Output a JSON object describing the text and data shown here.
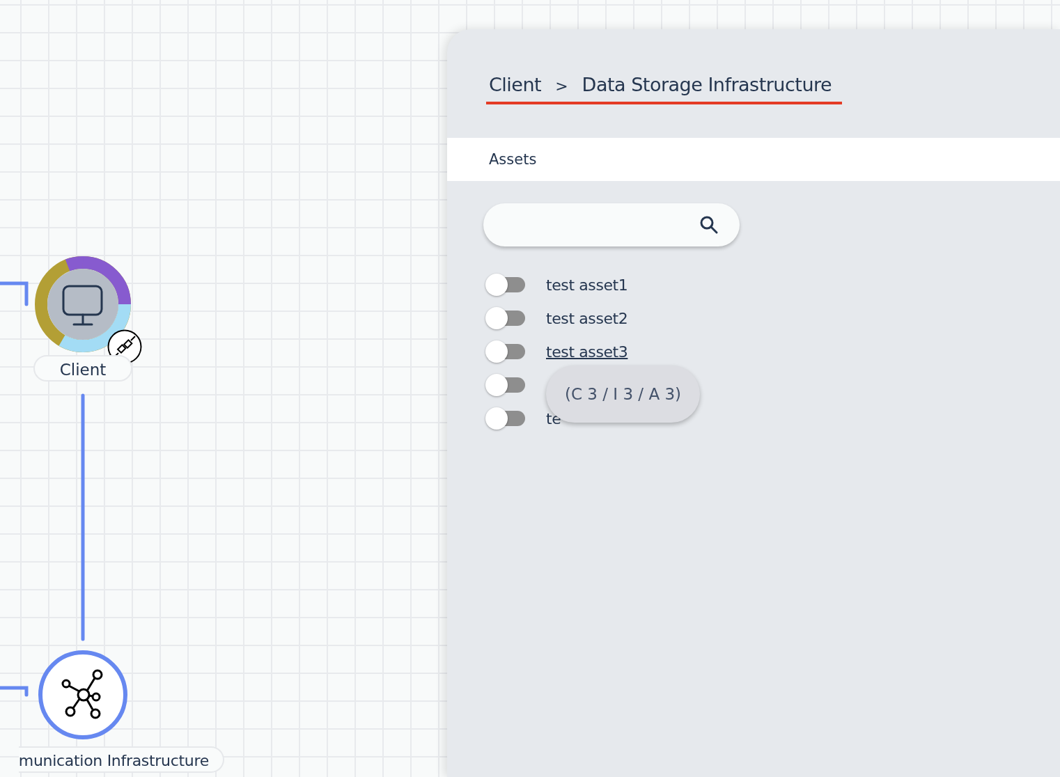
{
  "canvas": {
    "nodes": [
      {
        "kind": "ring",
        "label": "Client",
        "badge": true
      },
      {
        "kind": "network",
        "label": "munication Infrastructure",
        "badge": false
      }
    ]
  },
  "panel": {
    "breadcrumb": [
      "Client",
      "Data Storage Infrastructure"
    ],
    "separator": ">",
    "tabs": [
      {
        "label": "Assets",
        "selected": true
      }
    ],
    "assets": [
      {
        "label": "test asset1",
        "on": false,
        "hovered": false
      },
      {
        "label": "test asset2",
        "on": false,
        "hovered": false
      },
      {
        "label": "test asset3",
        "on": false,
        "hovered": true
      },
      {
        "on": false,
        "hovered": false
      },
      {
        "label": "te",
        "on": false,
        "hovered": false
      }
    ],
    "tooltip": "(C 3 / I 3 / A 3)"
  }
}
